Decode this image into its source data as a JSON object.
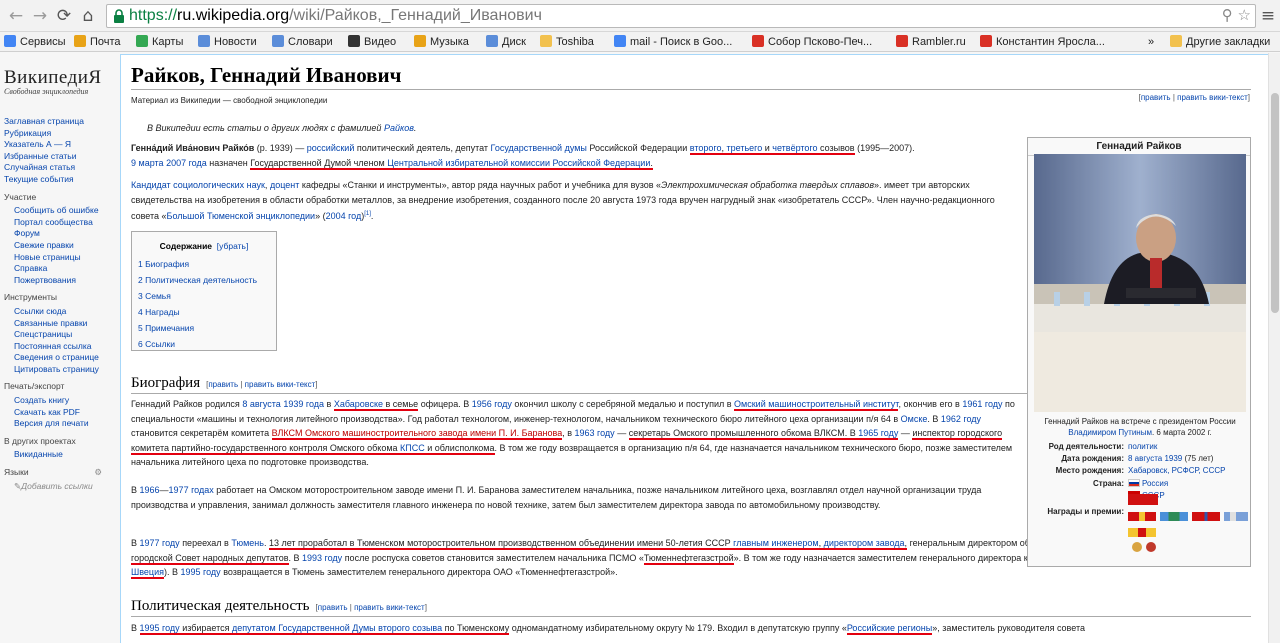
{
  "browser": {
    "url_scheme": "https://",
    "url_host": "ru.wikipedia.org",
    "url_path": "/wiki/Райков,_Геннадий_Иванович",
    "bookmarks": [
      {
        "label": "Сервисы",
        "color": "#4285f4"
      },
      {
        "label": "Почта",
        "color": "#e8a317"
      },
      {
        "label": "Карты",
        "color": "#34a853"
      },
      {
        "label": "Новости",
        "color": "#5b8dd9"
      },
      {
        "label": "Словари",
        "color": "#5b8dd9"
      },
      {
        "label": "Видео",
        "color": "#333333"
      },
      {
        "label": "Музыка",
        "color": "#e8a317"
      },
      {
        "label": "Диск",
        "color": "#5b8dd9"
      },
      {
        "label": "Toshiba",
        "color": "#f2c14e"
      },
      {
        "label": "mail - Поиск в Goo...",
        "color": "#4285f4"
      },
      {
        "label": "Собор Псково-Печ...",
        "color": "#d93025"
      },
      {
        "label": "Rambler.ru",
        "color": "#d93025"
      },
      {
        "label": "Константин Яросла...",
        "color": "#d93025"
      }
    ],
    "more_label": "»",
    "other_bookmarks": "Другие закладки"
  },
  "logo": {
    "title": "ВикипедиЯ",
    "subtitle": "Свободная энциклопедия"
  },
  "sidebar": {
    "main": [
      "Заглавная страница",
      "Рубрикация",
      "Указатель А — Я",
      "Избранные статьи",
      "Случайная статья",
      "Текущие события"
    ],
    "participation_head": "Участие",
    "participation": [
      "Сообщить об ошибке",
      "Портал сообщества",
      "Форум",
      "Свежие правки",
      "Новые страницы",
      "Справка",
      "Пожертвования"
    ],
    "tools_head": "Инструменты",
    "tools": [
      "Ссылки сюда",
      "Связанные правки",
      "Спецстраницы",
      "Постоянная ссылка",
      "Сведения о странице",
      "Цитировать страницу"
    ],
    "print_head": "Печать/экспорт",
    "print": [
      "Создать книгу",
      "Скачать как PDF",
      "Версия для печати"
    ],
    "other_head": "В других проектах",
    "other": [
      "Викиданные"
    ],
    "lang_head": "Языки",
    "add_links": "Добавить ссылки"
  },
  "article": {
    "title": "Райков, Геннадий Иванович",
    "tagline": "Материал из Википедии — свободной энциклопедии",
    "edit": "править",
    "edit_wiki": "править вики-текст",
    "hatnote_text": "В Википедии есть статьи о других людях с фамилией ",
    "hatnote_link": "Райков",
    "toc_title": "Содержание",
    "toc_hide": "убрать",
    "toc": [
      "1 Биография",
      "2 Политическая деятельность",
      "3 Семья",
      "4 Награды",
      "5 Примечания",
      "6 Ссылки"
    ],
    "sec_bio": "Биография",
    "sec_politics": "Политическая деятельность"
  },
  "infobox": {
    "title": "Геннадий Райков",
    "caption_1": "Геннадий Райков на встрече с президентом России",
    "caption_link": "Владимиром Путиным",
    "caption_2": ". 6 марта 2002 г.",
    "rows": [
      {
        "label": "Род деятельности:",
        "value": "политик"
      },
      {
        "label": "Дата рождения:",
        "value": "8 августа 1939",
        "extra": " (75 лет)"
      },
      {
        "label": "Место рождения:",
        "value": "Хабаровск, РСФСР, СССР"
      },
      {
        "label": "Страна:",
        "value": "Россия"
      },
      {
        "label": "",
        "value": "СССР"
      },
      {
        "label": "Награды и премии:",
        "value": ""
      }
    ]
  }
}
